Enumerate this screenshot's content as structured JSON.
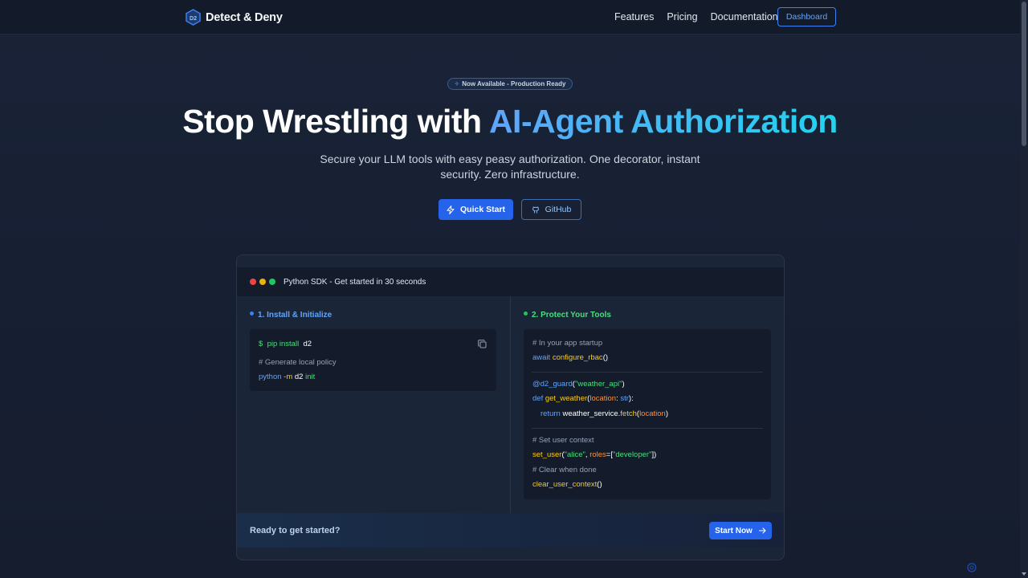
{
  "nav": {
    "logo_text": "D2",
    "brand": "Detect & Deny",
    "links": [
      "Features",
      "Pricing",
      "Documentation"
    ],
    "dashboard_label": "Dashboard"
  },
  "hero": {
    "badge_icon": "sparkle-icon",
    "badge": "Now Available - Production Ready",
    "title_prefix": "Stop Wrestling with ",
    "title_accent": "AI-Agent Authorization",
    "subtitle": "Secure your LLM tools with easy peasy authorization. One decorator, instant security. Zero infrastructure.",
    "quickstart_label": "Quick Start",
    "github_label": "GitHub"
  },
  "card": {
    "header_title": "Python SDK - Get started in 30 seconds",
    "col1_title": "1. Install & Initialize",
    "col2_title": "2. Protect Your Tools",
    "install": {
      "prompt": "$",
      "cmd": "pip install",
      "pkg": "d2",
      "comment": "# Generate local policy",
      "run_python": "python",
      "run_flag": "-m",
      "run_module": "d2",
      "run_arg": "init"
    },
    "protect": {
      "comment1": "# In your app startup",
      "await_kw": "await",
      "configure_fn": "configure_rbac",
      "call_parens": "()",
      "decorator": "@d2_guard",
      "decorator_open": "(",
      "decorator_arg": "\"weather_api\"",
      "decorator_close": ")",
      "def_kw": "def",
      "fn_name": "get_weather",
      "param_open": "(",
      "param": "location",
      "param_colon": ": ",
      "param_type": "str",
      "param_close": "):",
      "return_kw": "return",
      "return_obj": "weather_service.",
      "return_method": "fetch",
      "return_open": "(",
      "return_arg": "location",
      "return_close": ")",
      "comment2": "# Set user context",
      "set_user_fn": "set_user",
      "set_user_open": "(",
      "set_user_arg": "\"alice\"",
      "set_user_comma": ", ",
      "roles_kw": "roles",
      "roles_eq": "=[",
      "roles_val": "\"developer\"",
      "roles_close": "])",
      "comment3": "# Clear when done",
      "clear_fn": "clear_user_context",
      "clear_parens": "()"
    },
    "footer_text": "Ready to get started?",
    "start_label": "Start Now"
  },
  "colors": {
    "accent": "#2563eb",
    "accent_light": "#60a5fa",
    "gradient_end": "#22d3ee",
    "success": "#22c55e",
    "background": "#172033"
  }
}
